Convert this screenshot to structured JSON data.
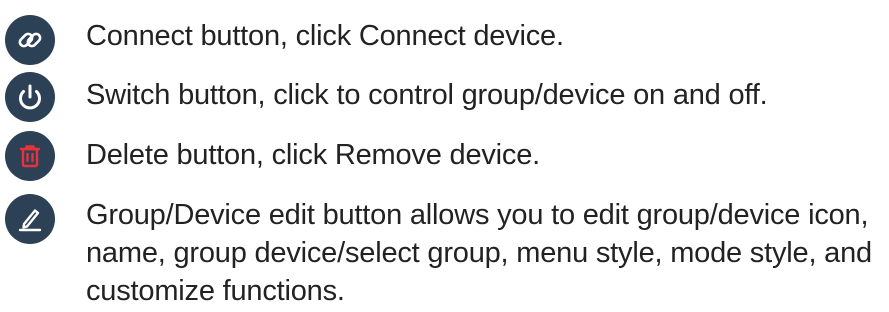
{
  "legend": {
    "items": [
      {
        "icon": "link-icon",
        "icon_color": "#ffffff",
        "text": "Connect button, click Connect device."
      },
      {
        "icon": "power-icon",
        "icon_color": "#ffffff",
        "text": "Switch button, click to control group/device on and off."
      },
      {
        "icon": "trash-icon",
        "icon_color": "#e8323c",
        "text": "Delete button, click Remove device."
      },
      {
        "icon": "pencil-icon",
        "icon_color": "#ffffff",
        "text": "Group/Device edit button allows you to edit group/device icon, name, group device/select group, menu style, mode style, and customize functions."
      }
    ]
  },
  "colors": {
    "icon_background": "#2c4056",
    "text": "#222222"
  }
}
